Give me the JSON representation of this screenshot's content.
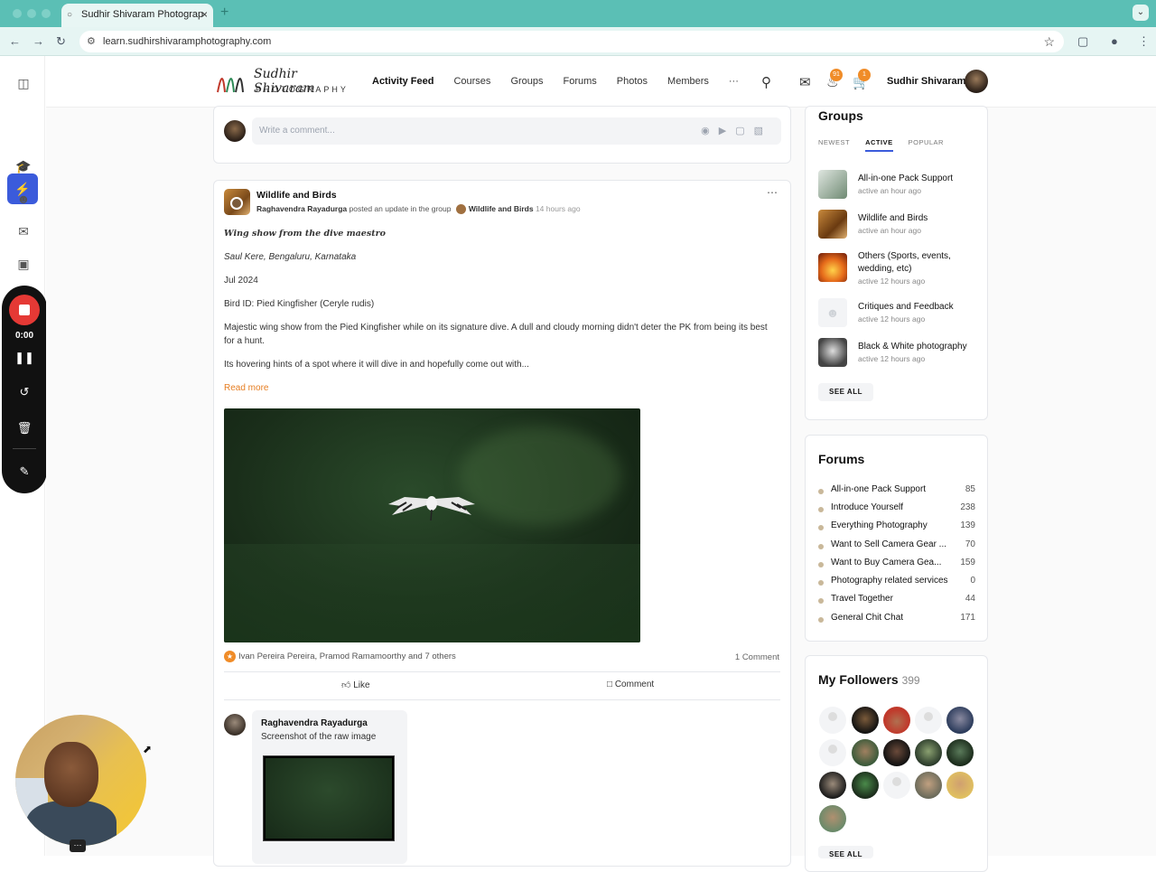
{
  "browser": {
    "tab_title": "Sudhir Shivaram Photograp",
    "url": "learn.sudhirshivaramphotography.com"
  },
  "leftbar": {
    "icons": [
      "sidebar-toggle-icon",
      "activity-icon",
      "courses-icon",
      "groups-icon",
      "forums-icon",
      "photos-icon",
      "edit-icon"
    ]
  },
  "recorder": {
    "time": "0:00"
  },
  "header": {
    "logo_script": "Sudhir Shivaram",
    "logo_sub": "PHOTOGRAPHY",
    "nav": [
      "Activity Feed",
      "Courses",
      "Groups",
      "Forums",
      "Photos",
      "Members",
      "···"
    ],
    "notifications_count": "91",
    "cart_count": "1",
    "user_name": "Sudhir Shivaram"
  },
  "comment_box": {
    "placeholder": "Write a comment..."
  },
  "post": {
    "group_name": "Wildlife and Birds",
    "author": "Raghavendra Rayadurga",
    "action": "posted an update in the group",
    "group_link": "Wildlife and Birds",
    "time": "14 hours ago",
    "lines": [
      "Wing show from the dive maestro",
      "Saul Kere, Bengaluru, Karnataka",
      "Jul 2024",
      "Bird ID: Pied Kingfisher (Ceryle rudis)",
      "Majestic wing show from the Pied Kingfisher while on its signature dive. A dull and cloudy morning didn't deter the PK from being its best for a hunt.",
      "Its hovering hints of a spot where it will dive in and hopefully come out with..."
    ],
    "read_more": "Read more",
    "likes": "Ivan Pereira Pereira, Pramod Ramamoorthy and 7 others",
    "comment_count": "1 Comment",
    "like_label": "Like",
    "comment_label": "Comment",
    "reply": {
      "author": "Raghavendra Rayadurga",
      "text": "Screenshot of the raw image"
    }
  },
  "groups": {
    "title": "Groups",
    "tabs": [
      "NEWEST",
      "ACTIVE",
      "POPULAR"
    ],
    "items": [
      {
        "name": "All-in-one Pack Support",
        "active": "active an hour ago"
      },
      {
        "name": "Wildlife and Birds",
        "active": "active an hour ago"
      },
      {
        "name": "Others (Sports, events, wedding, etc)",
        "active": "active 12 hours ago"
      },
      {
        "name": "Critiques and Feedback",
        "active": "active 12 hours ago"
      },
      {
        "name": "Black & White photography",
        "active": "active 12 hours ago"
      }
    ],
    "see_all": "SEE ALL"
  },
  "forums": {
    "title": "Forums",
    "items": [
      {
        "name": "All-in-one Pack Support",
        "count": "85"
      },
      {
        "name": "Introduce Yourself",
        "count": "238"
      },
      {
        "name": "Everything Photography",
        "count": "139"
      },
      {
        "name": "Want to Sell Camera Gear ...",
        "count": "70"
      },
      {
        "name": "Want to Buy Camera Gea...",
        "count": "159"
      },
      {
        "name": "Photography related services",
        "count": "0"
      },
      {
        "name": "Travel Together",
        "count": "44"
      },
      {
        "name": "General Chit Chat",
        "count": "171"
      }
    ]
  },
  "followers": {
    "title": "My Followers",
    "count": "399",
    "see_all": "SEE ALL"
  }
}
